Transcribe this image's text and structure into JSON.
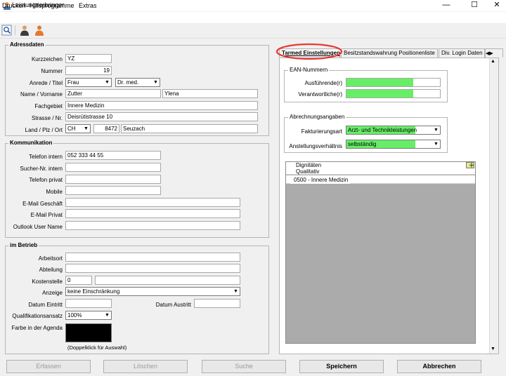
{
  "window": {
    "title": "Leistungserbringer",
    "minimize": "—",
    "maximize": "☐",
    "close": "✕"
  },
  "menu": {
    "items": [
      "Drucken",
      "Hilfsprogramme",
      "Extras"
    ]
  },
  "toolbar": {
    "icons": [
      "search-document-icon",
      "user-icon",
      "user-icon"
    ]
  },
  "adress": {
    "title": "Adressdaten",
    "kurzzeichen_label": "Kurzzeichen",
    "kurzzeichen": "YZ",
    "nummer_label": "Nummer",
    "nummer": "19",
    "anrede_label": "Anrede / Titel",
    "anrede": "Frau",
    "titel": "Dr. med.",
    "name_label": "Name / Vorname",
    "name": "Zutter",
    "vorname": "Ylena",
    "fachgebiet_label": "Fachgebiet",
    "fachgebiet": "Innere Medizin",
    "strasse_label": "Strasse / Nr.",
    "strasse": "Deisrütistrasse 10",
    "land_label": "Land / Plz / Ort",
    "land": "CH",
    "plz": "8472",
    "ort": "Seuzach"
  },
  "komm": {
    "title": "Kommunikation",
    "telefon_intern_label": "Telefon intern",
    "telefon_intern": "052 333 44 55",
    "sucher_label": "Sucher-Nr. intern",
    "sucher": "",
    "telefon_privat_label": "Telefon privat",
    "telefon_privat": "",
    "mobile_label": "Mobile",
    "mobile": "",
    "email_g_label": "E-Mail Geschäft",
    "email_g": "",
    "email_p_label": "E-Mail Privat",
    "email_p": "",
    "outlook_label": "Outlook User Name",
    "outlook": ""
  },
  "betrieb": {
    "title": "im Betrieb",
    "arbeitsort_label": "Arbeitsort",
    "arbeitsort": "",
    "abteilung_label": "Abteilung",
    "abteilung": "",
    "kostenstelle_label": "Kostenstelle",
    "kostenstelle": "0",
    "kostenstelle_text": "",
    "anzeige_label": "Anzeige",
    "anzeige": "keine Einschränkung",
    "datum_eintritt_label": "Datum Eintritt",
    "datum_eintritt": "",
    "datum_austritt_label": "Datum Austritt",
    "datum_austritt": "",
    "qualifikation_label": "Qualifikationsansatz",
    "qualifikation": "100%",
    "farbe_label": "Farbe in der Agenda",
    "farbe_color": "#000000",
    "farbe_hint": "(Doppelklick für Auswahl)"
  },
  "tabs": [
    "Tarmed Einstellungen",
    "Besitzstandswahrung Positionenliste",
    "Div. Login Daten"
  ],
  "tarmed": {
    "ean_title": "EAN-Nummern",
    "ausfuehrende_label": "Ausführende(r)",
    "ausfuehrende": "",
    "verantwortliche_label": "Verantwortliche(r)",
    "verantwortliche": "",
    "abrechnung_title": "Abrechnungsangaben",
    "fakturierungsart_label": "Fakturierungsart",
    "fakturierungsart": "Arzt- und Technikleistungen",
    "anstellung_label": "Anstellungsverhältnis",
    "anstellung": "selbständig",
    "grid_header1": "Dignitäten",
    "grid_header2": "Qualitativ",
    "grid_rows": [
      "0500 - Innere Medizin"
    ]
  },
  "buttons": {
    "erfassen": "Erfassen",
    "loeschen": "Löschen",
    "suche": "Suche",
    "speichern": "Speichern",
    "abbrechen": "Abbrechen"
  },
  "colors": {
    "highlight": "#66ee66",
    "annotation": "#e53935"
  }
}
